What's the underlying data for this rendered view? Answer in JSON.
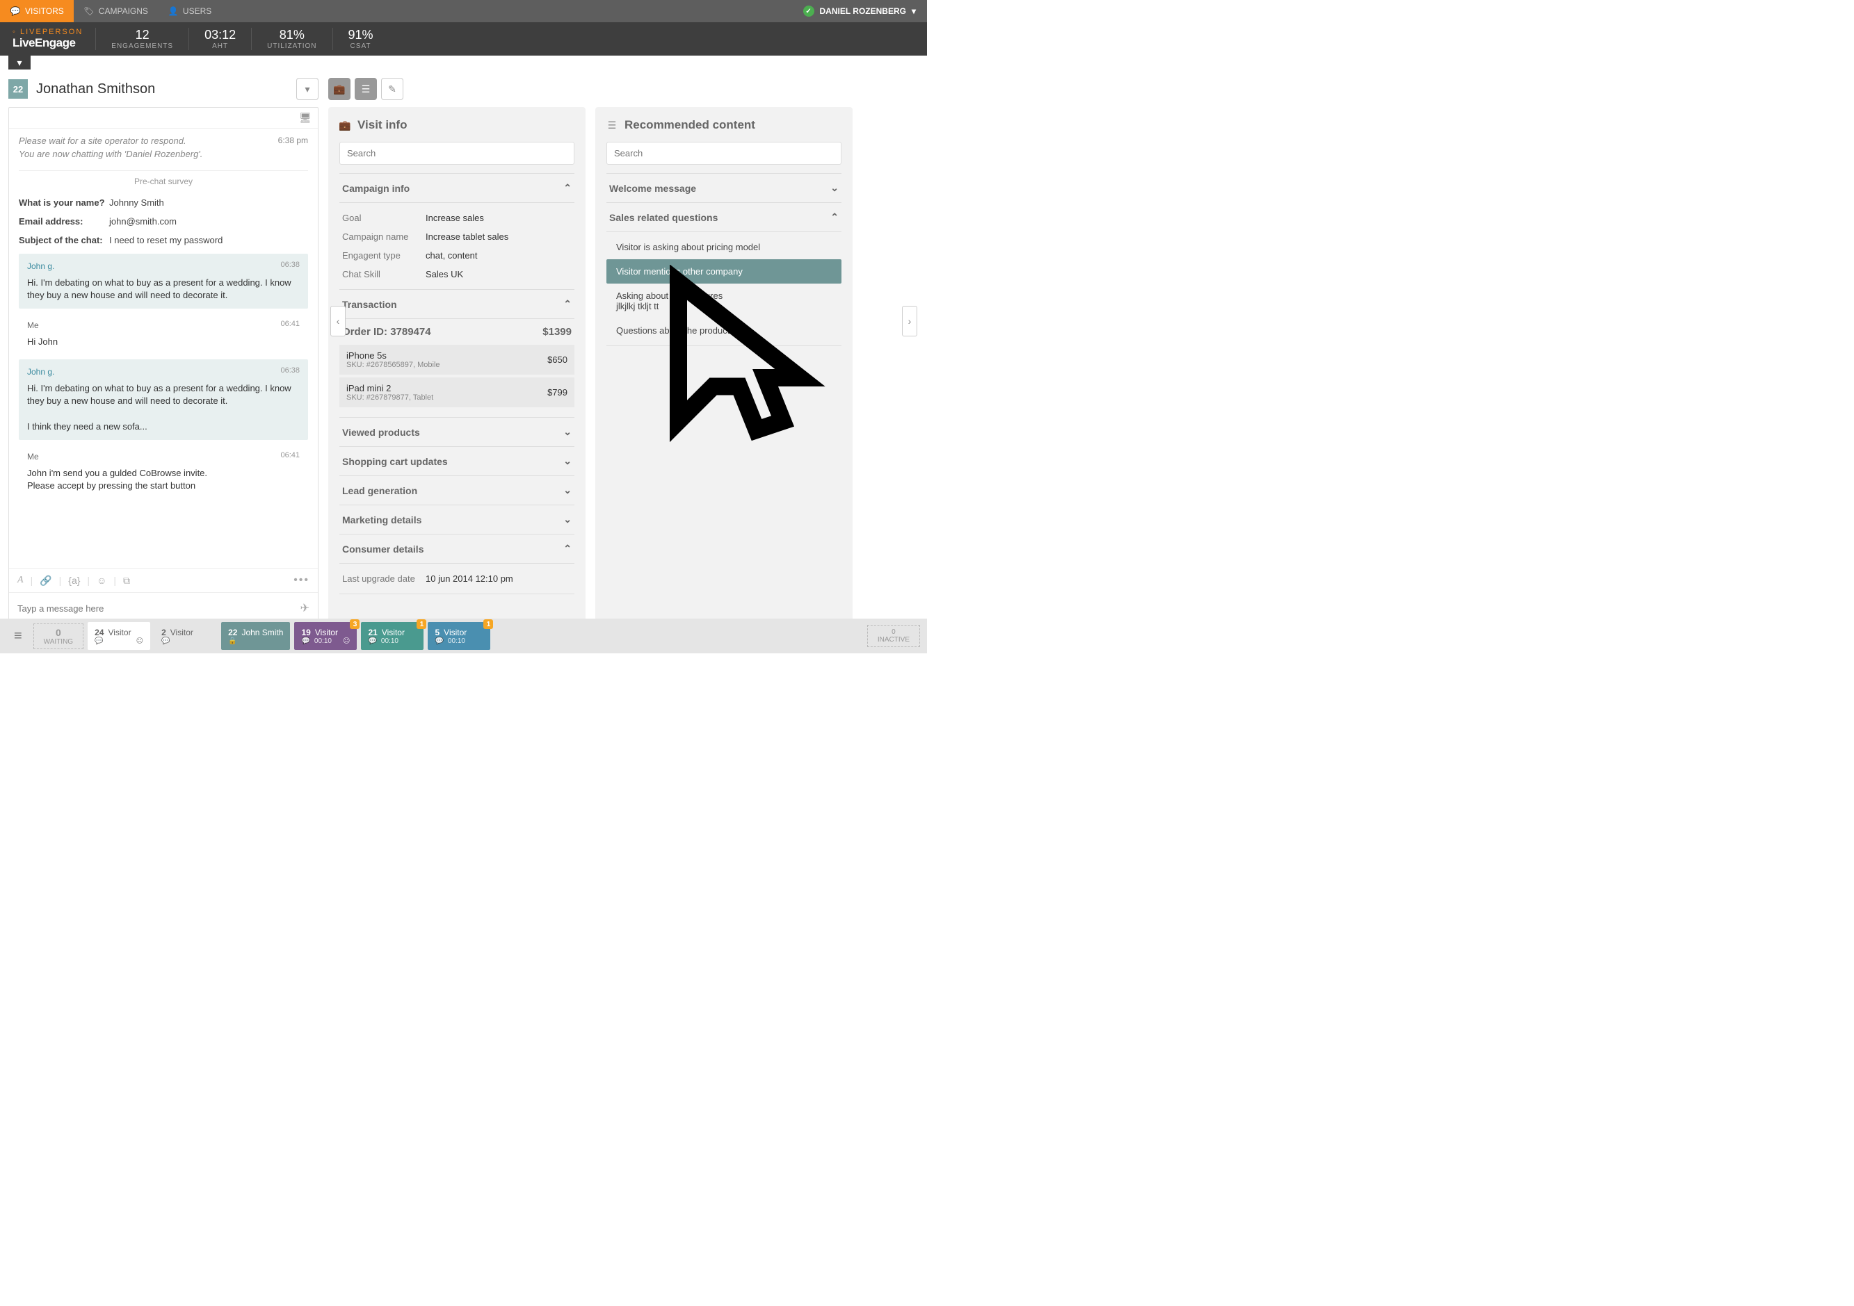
{
  "topnav": {
    "tabs": [
      "VISITORS",
      "CAMPAIGNS",
      "USERS"
    ],
    "user": "DANIEL ROZENBERG"
  },
  "logo": {
    "top": "LIVEPERSON",
    "brand": "LiveEngage"
  },
  "metrics": [
    {
      "val": "12",
      "lab": "ENGAGEMENTS"
    },
    {
      "val": "03:12",
      "lab": "AHT"
    },
    {
      "val": "81%",
      "lab": "UTILIZATION"
    },
    {
      "val": "91%",
      "lab": "CSAT"
    }
  ],
  "chat": {
    "num": "22",
    "name": "Jonathan Smithson",
    "sys": [
      {
        "t": "Please wait for a site operator to respond.",
        "time": "6:38 pm"
      },
      {
        "t": "You are now chatting with 'Daniel Rozenberg'."
      }
    ],
    "divider": "Pre-chat survey",
    "survey": [
      [
        "What is your name?",
        "Johnny Smith"
      ],
      [
        "Email address:",
        "john@smith.com"
      ],
      [
        "Subject of the chat:",
        "I need to reset my password"
      ]
    ],
    "messages": [
      {
        "from": "John g.",
        "time": "06:38",
        "cls": "visitor",
        "body": "Hi. I'm debating on what to buy as a present for a wedding. I know they buy a new house and will need to decorate it."
      },
      {
        "from": "Me",
        "time": "06:41",
        "cls": "me",
        "body": "Hi John"
      },
      {
        "from": "John g.",
        "time": "06:38",
        "cls": "visitor",
        "body": "Hi. I'm debating on what to buy as a present for a wedding. I know they buy a new house and will need to decorate it.\n\nI think they need a new sofa..."
      },
      {
        "from": "Me",
        "time": "06:41",
        "cls": "me",
        "body": "John i'm send you a gulded CoBrowse invite.\nPlease accept by pressing the start button"
      }
    ],
    "placeholder": "Tayp a message here"
  },
  "visit": {
    "title": "Visit info",
    "searchPh": "Search",
    "campaign": {
      "title": "Campaign info",
      "rows": [
        [
          "Goal",
          "Increase sales"
        ],
        [
          "Campaign name",
          "Increase tablet sales"
        ],
        [
          "Engagent type",
          "chat, content"
        ],
        [
          "Chat Skill",
          "Sales UK"
        ]
      ]
    },
    "trans": {
      "title": "Transaction",
      "orderLabel": "Order ID:",
      "orderId": "3789474",
      "total": "$1399",
      "items": [
        {
          "name": "iPhone 5s",
          "sku": "SKU: #2678565897, Mobile",
          "price": "$650"
        },
        {
          "name": "iPad mini 2",
          "sku": "SKU: #267879877, Tablet",
          "price": "$799"
        }
      ]
    },
    "sections": [
      "Viewed products",
      "Shopping cart updates",
      "Lead generation",
      "Marketing details"
    ],
    "consumer": {
      "title": "Consumer details",
      "rows": [
        [
          "Last upgrade date",
          "10 jun 2014 12:10 pm"
        ]
      ]
    }
  },
  "rec": {
    "title": "Recommended content",
    "searchPh": "Search",
    "groups": [
      {
        "title": "Welcome message",
        "open": false
      },
      {
        "title": "Sales related questions",
        "open": true,
        "items": [
          {
            "t": "Visitor is asking about pricing model"
          },
          {
            "t": "Visitor mentions other company",
            "sel": true
          },
          {
            "t": "Asking about new features\njlkjlkj tkljt tt"
          },
          {
            "t": "Questions about the product"
          }
        ]
      }
    ]
  },
  "bottom": {
    "waiting": {
      "n": "0",
      "lab": "WAITING"
    },
    "tabs": [
      {
        "n": "24",
        "name": "Visitor",
        "cls": "white",
        "face": true
      },
      {
        "n": "2",
        "name": "Visitor",
        "cls": "grey"
      },
      {
        "n": "22",
        "name": "John Smith",
        "cls": "dark",
        "lock": true
      },
      {
        "n": "19",
        "name": "Visitor",
        "cls": "purple",
        "time": "00:10",
        "badge": "3",
        "face": true
      },
      {
        "n": "21",
        "name": "Visitor",
        "cls": "teal",
        "time": "00:10",
        "badge": "1"
      },
      {
        "n": "5",
        "name": "Visitor",
        "cls": "blue",
        "time": "00:10",
        "badge": "1"
      }
    ],
    "inactive": {
      "n": "0",
      "lab": "INACTIVE"
    }
  }
}
